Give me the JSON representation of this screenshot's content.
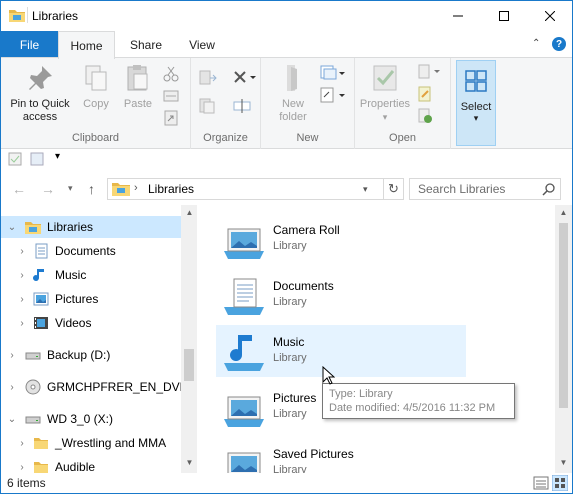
{
  "window": {
    "title": "Libraries"
  },
  "ribbon_tabs": {
    "file": "File",
    "home": "Home",
    "share": "Share",
    "view": "View"
  },
  "ribbon": {
    "clipboard": {
      "label": "Clipboard",
      "pin": "Pin to Quick access",
      "copy": "Copy",
      "paste": "Paste"
    },
    "organize": {
      "label": "Organize"
    },
    "new": {
      "label": "New",
      "new_folder": "New folder"
    },
    "open": {
      "label": "Open",
      "properties": "Properties"
    },
    "select": {
      "label": "Select"
    }
  },
  "address": {
    "crumb": "Libraries",
    "search_placeholder": "Search Libraries"
  },
  "nav": [
    {
      "label": "Libraries",
      "selected": true
    },
    {
      "label": "Documents"
    },
    {
      "label": "Music"
    },
    {
      "label": "Pictures"
    },
    {
      "label": "Videos"
    },
    {
      "label": "Backup (D:)"
    },
    {
      "label": "GRMCHPFRER_EN_DVD (E"
    },
    {
      "label": "WD 3_0 (X:)"
    },
    {
      "label": "_Wrestling and MMA"
    },
    {
      "label": "Audible"
    }
  ],
  "items": [
    {
      "name": "Camera Roll",
      "type": "Library"
    },
    {
      "name": "Documents",
      "type": "Library"
    },
    {
      "name": "Music",
      "type": "Library"
    },
    {
      "name": "Pictures",
      "type": "Library"
    },
    {
      "name": "Saved Pictures",
      "type": "Library"
    }
  ],
  "tooltip": {
    "type": "Type: Library",
    "modified": "Date modified: 4/5/2016 11:32 PM"
  },
  "status": {
    "count": "6 items"
  },
  "colors": {
    "accent": "#1979ca",
    "selection": "#cce8ff",
    "hover": "#e5f3ff"
  }
}
